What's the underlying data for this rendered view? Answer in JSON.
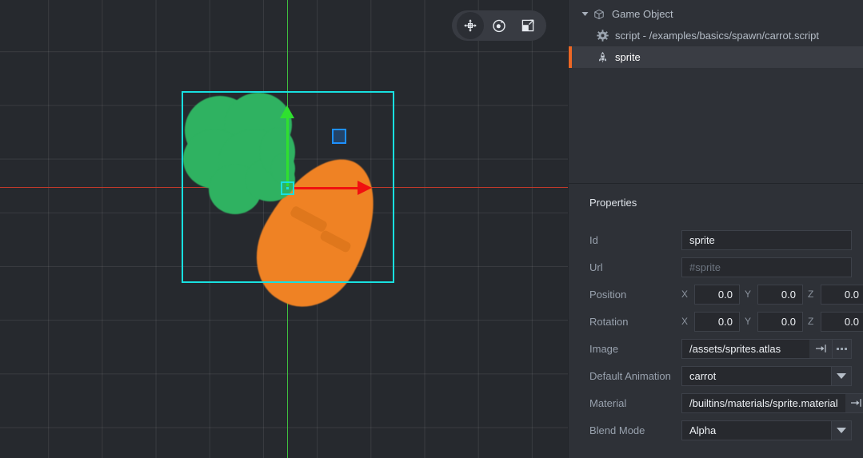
{
  "viewport": {
    "toolbar": {
      "tools": [
        {
          "name": "move-tool",
          "label": "Move",
          "active": true
        },
        {
          "name": "rotate-tool",
          "label": "Rotate",
          "active": false
        },
        {
          "name": "scale-tool",
          "label": "Scale",
          "active": false
        }
      ]
    },
    "gizmo": {
      "x_axis_color": "#f01010",
      "y_axis_color": "#2fe02f",
      "z_plane_color": "#1e90ff",
      "selection_color": "#18e0e0"
    },
    "scene_object": "carrot sprite",
    "grid_color": "#3a3e45",
    "background_color": "#26292e"
  },
  "outline": {
    "items": [
      {
        "label": "Game Object",
        "icon": "cube-icon",
        "depth": 0,
        "expanded": true,
        "selected": false
      },
      {
        "label": "script - /examples/basics/spawn/carrot.script",
        "icon": "gear-icon",
        "depth": 1,
        "selected": false
      },
      {
        "label": "sprite",
        "icon": "sprite-icon",
        "depth": 1,
        "selected": true
      }
    ]
  },
  "properties": {
    "title": "Properties",
    "id": {
      "label": "Id",
      "value": "sprite"
    },
    "url": {
      "label": "Url",
      "placeholder": "#sprite",
      "value": ""
    },
    "position": {
      "label": "Position",
      "x_label": "X",
      "y_label": "Y",
      "z_label": "Z",
      "x": "0.0",
      "y": "0.0",
      "z": "0.0"
    },
    "rotation": {
      "label": "Rotation",
      "x_label": "X",
      "y_label": "Y",
      "z_label": "Z",
      "x": "0.0",
      "y": "0.0",
      "z": "0.0"
    },
    "image": {
      "label": "Image",
      "value": "/assets/sprites.atlas",
      "goto_icon": "goto-resource-icon",
      "browse_icon": "ellipsis-icon"
    },
    "default_animation": {
      "label": "Default Animation",
      "value": "carrot",
      "dropdown_icon": "chevron-down-icon"
    },
    "material": {
      "label": "Material",
      "value": "/builtins/materials/sprite.material",
      "goto_icon": "goto-resource-icon",
      "browse_icon": "ellipsis-icon"
    },
    "blend_mode": {
      "label": "Blend Mode",
      "value": "Alpha",
      "dropdown_icon": "chevron-down-icon"
    }
  },
  "theme": {
    "accent": "#ec6725",
    "panel_bg": "#2e3137",
    "field_bg": "#27292e",
    "selected_row_bg": "#3a3d44"
  }
}
